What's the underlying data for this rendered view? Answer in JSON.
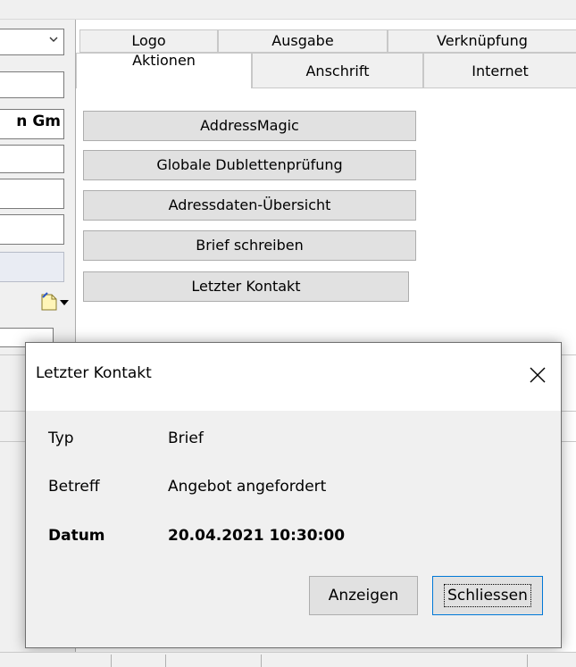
{
  "tabs_row1": [
    "Logo",
    "Ausgabe",
    "Verknüpfung"
  ],
  "tabs_row2": [
    "Aktionen",
    "Anschrift",
    "Internet"
  ],
  "active_tab": "Aktionen",
  "left_panel": {
    "company_fragment": "n Gm"
  },
  "actions": [
    "AddressMagic",
    "Globale Dublettenprüfung",
    "Adressdaten-Übersicht",
    "Brief schreiben",
    "Letzter Kontakt"
  ],
  "dialog": {
    "title": "Letzter Kontakt",
    "rows": [
      {
        "label": "Typ",
        "value": "Brief"
      },
      {
        "label": "Betreff",
        "value": "Angebot angefordert"
      },
      {
        "label": "Datum",
        "value": "20.04.2021 10:30:00"
      }
    ],
    "buttons": {
      "show": "Anzeigen",
      "close": "Schliessen"
    }
  },
  "icons": {
    "close": "close-icon",
    "combo": "chevron-down-icon",
    "note": "note-icon"
  },
  "colors": {
    "window_bg": "#f0f0f0",
    "button_bg": "#e1e1e1",
    "focus_border": "#0078d7"
  }
}
